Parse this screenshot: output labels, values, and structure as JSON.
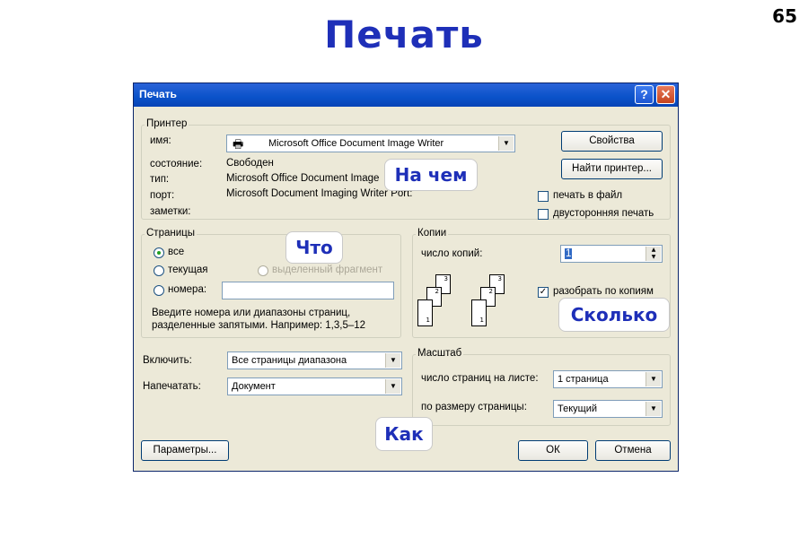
{
  "slide": {
    "title": "Печать",
    "page_number": "65"
  },
  "dialog": {
    "title": "Печать",
    "help_glyph": "?",
    "close_glyph": "✕",
    "printer": {
      "group_title": "Принтер",
      "name_label": "имя:",
      "name_value": "Microsoft Office Document Image Writer",
      "status_label": "состояние:",
      "status_value": "Свободен",
      "type_label": "тип:",
      "type_value": "Microsoft Office Document Image",
      "port_label": "порт:",
      "port_value": "Microsoft Document Imaging Writer Port:",
      "notes_label": "заметки:",
      "properties_button": "Свойства",
      "find_printer_button": "Найти принтер...",
      "print_to_file_label": "печать в файл",
      "duplex_label": "двусторонняя печать"
    },
    "pages": {
      "group_title": "Страницы",
      "all_label": "все",
      "current_label": "текущая",
      "selection_label": "выделенный фрагмент",
      "numbers_label": "номера:",
      "numbers_value": "",
      "hint_line1": "Введите номера или диапазоны страниц,",
      "hint_line2": "разделенные запятыми. Например: 1,3,5–12"
    },
    "copies": {
      "group_title": "Копии",
      "count_label": "число копий:",
      "count_value": "1",
      "collate_label": "разобрать по копиям",
      "collate_checked": true
    },
    "include": {
      "label": "Включить:",
      "value": "Все страницы диапазона"
    },
    "print_what": {
      "label": "Напечатать:",
      "value": "Документ"
    },
    "scale": {
      "group_title": "Масштаб",
      "pages_per_sheet_label": "число страниц на листе:",
      "pages_per_sheet_value": "1 страница",
      "fit_to_label": "по размеру страницы:",
      "fit_to_value": "Текущий"
    },
    "options_button": "Параметры...",
    "ok_button": "ОК",
    "cancel_button": "Отмена"
  },
  "callouts": {
    "on_what": "На чем",
    "what": "Что",
    "how_many": "Сколько",
    "how": "Как"
  },
  "colors": {
    "slide_title": "#1e2fb8",
    "dialog_bg": "#ece9d8",
    "titlebar": "#0a52c9"
  }
}
